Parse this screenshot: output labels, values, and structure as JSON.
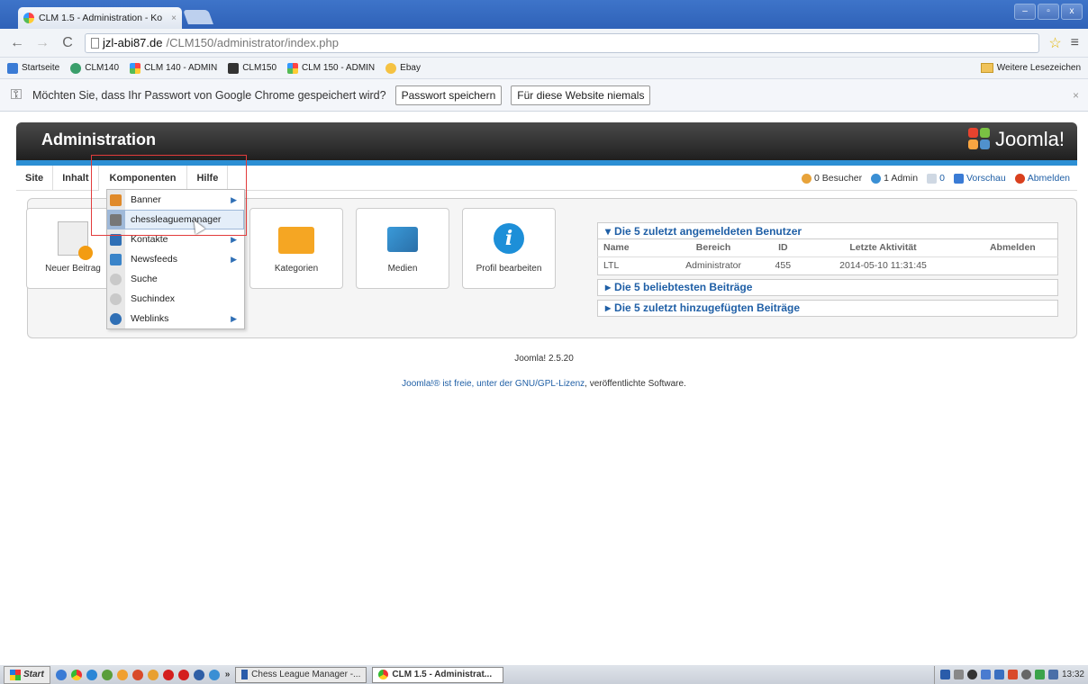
{
  "browser": {
    "tab_title": "CLM 1.5 - Administration - Ko",
    "tab_close": "×",
    "url_host": "jzl-abi87.de",
    "url_path": "/CLM150/administrator/index.php",
    "window_controls": [
      "–",
      "▫",
      "x"
    ]
  },
  "bookmarks": {
    "items": [
      "Startseite",
      "CLM140",
      "CLM 140 - ADMIN",
      "CLM150",
      "CLM 150 - ADMIN",
      "Ebay"
    ],
    "other": "Weitere Lesezeichen"
  },
  "infobar": {
    "message": "Möchten Sie, dass Ihr Passwort von Google Chrome gespeichert wird?",
    "save_button": "Passwort speichern",
    "never_button": "Für diese Website niemals",
    "close": "×"
  },
  "admin": {
    "title": "Administration",
    "logo_text": "Joomla!",
    "menu": [
      "Site",
      "Inhalt",
      "Komponenten",
      "Hilfe"
    ],
    "status": {
      "visitors": "0 Besucher",
      "admins": "1 Admin",
      "messages": "0",
      "preview": "Vorschau",
      "logout": "Abmelden"
    }
  },
  "dropdown": {
    "items": [
      {
        "label": "Banner",
        "submenu": true,
        "color": "#e08a2a"
      },
      {
        "label": "chessleaguemanager",
        "submenu": false,
        "color": "#777777"
      },
      {
        "label": "Kontakte",
        "submenu": true,
        "color": "#2f6fb5"
      },
      {
        "label": "Newsfeeds",
        "submenu": true,
        "color": "#3a84c9"
      },
      {
        "label": "Suche",
        "submenu": false,
        "color": "#c9c9c9"
      },
      {
        "label": "Suchindex",
        "submenu": false,
        "color": "#c9c9c9"
      },
      {
        "label": "Weblinks",
        "submenu": true,
        "color": "#2f6fb5"
      }
    ]
  },
  "tiles": [
    "Neuer Beitrag",
    "Kategorien",
    "Medien",
    "Profil bearbeiten"
  ],
  "logged_in": {
    "title": "Die 5 zuletzt angemeldeten Benutzer",
    "columns": [
      "Name",
      "Bereich",
      "ID",
      "Letzte Aktivität",
      "Abmelden"
    ],
    "rows": [
      [
        "LTL",
        "Administrator",
        "455",
        "2014-05-10 11:31:45",
        ""
      ]
    ]
  },
  "accordions": [
    "Die 5 beliebtesten Beiträge",
    "Die 5 zuletzt hinzugefügten Beiträge"
  ],
  "footer": {
    "version": "Joomla! 2.5.20",
    "license_pre": "Joomla!® ist freie, unter der ",
    "license_link": "GNU/GPL-Lizenz",
    "license_post": ", veröffentlichte Software."
  },
  "taskbar": {
    "start": "Start",
    "chevron": "»",
    "tasks": [
      "Chess League Manager -...",
      "CLM 1.5 - Administrat..."
    ],
    "clock": "13:32"
  },
  "colors": {
    "accent": "#2c8fd4",
    "link": "#1f5fa6",
    "header_dark": "#1f1f1f",
    "highlight_box": "#e23b3b"
  }
}
